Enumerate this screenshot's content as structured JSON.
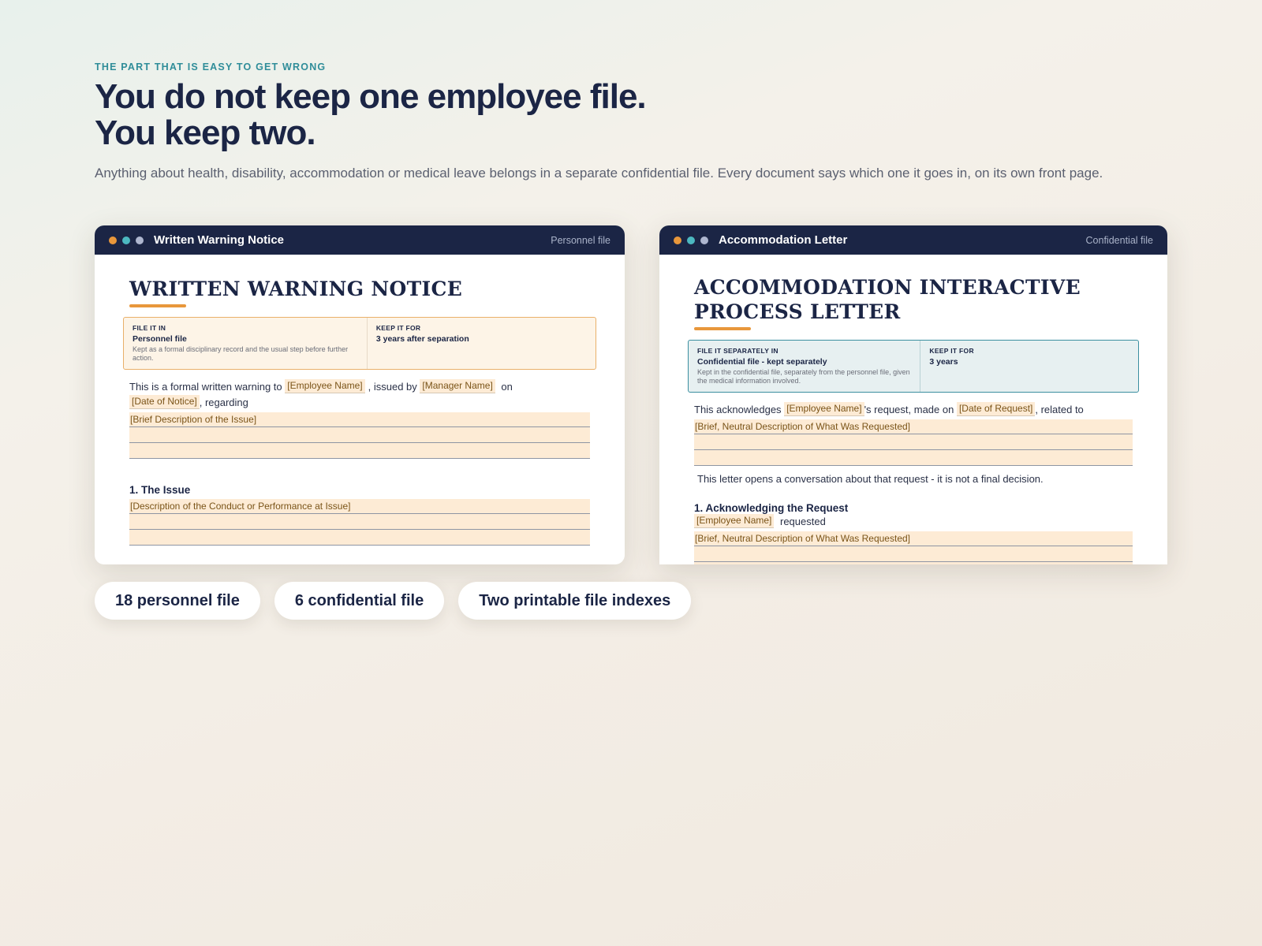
{
  "hero": {
    "eyebrow": "THE PART THAT IS EASY TO GET WRONG",
    "headline_line1": "You do not keep one employee file.",
    "headline_line2": "You keep two.",
    "subtitle": "Anything about health, disability, accommodation or medical leave belongs in a separate confidential file. Every document says which one it goes in, on its own front page."
  },
  "left_window": {
    "title": "Written Warning Notice",
    "badge": "Personnel file",
    "doc_title": "WRITTEN WARNING NOTICE",
    "filing": {
      "label1": "FILE IT IN",
      "value1": "Personnel file",
      "note1": "Kept as a formal disciplinary record and the usual step before further action.",
      "label2": "KEEP IT FOR",
      "value2": "3 years after separation"
    },
    "para": {
      "t1": "This is a formal written warning to",
      "ph1": "[Employee Name]",
      "t2": ", issued by",
      "ph2": "[Manager Name]",
      "t3": "on",
      "ph3": "[Date of Notice]",
      "t4": ", regarding",
      "ph4": "[Brief Description of the Issue]"
    },
    "section1": {
      "heading": "1. The Issue",
      "ph": "[Description of the Conduct or Performance at Issue]"
    }
  },
  "right_window": {
    "title": "Accommodation Letter",
    "badge": "Confidential file",
    "doc_title_line1": "ACCOMMODATION INTERACTIVE",
    "doc_title_line2": "PROCESS LETTER",
    "filing": {
      "label1": "FILE IT SEPARATELY IN",
      "value1": "Confidential file - kept separately",
      "note1": "Kept in the confidential file, separately from the personnel file, given the medical information involved.",
      "label2": "KEEP IT FOR",
      "value2": "3 years"
    },
    "para": {
      "t1": "This acknowledges",
      "ph1": "[Employee Name]",
      "t2": "'s request, made on",
      "ph2": "[Date of Request]",
      "t3": ", related to",
      "ph3": "[Brief, Neutral Description of What Was Requested]"
    },
    "note": "This letter opens a conversation about that request - it is not a final decision.",
    "section1": {
      "heading": "1. Acknowledging the Request",
      "ph1": "[Employee Name]",
      "t1": "requested",
      "ph2": "[Brief, Neutral Description of What Was Requested]"
    }
  },
  "chips": [
    "18 personnel file",
    "6 confidential file",
    "Two printable file indexes"
  ],
  "colors": {
    "navy": "#1b2545",
    "accent_orange": "#e8973b",
    "accent_teal": "#2f8d99",
    "placeholder_bg": "#fdebd5"
  }
}
